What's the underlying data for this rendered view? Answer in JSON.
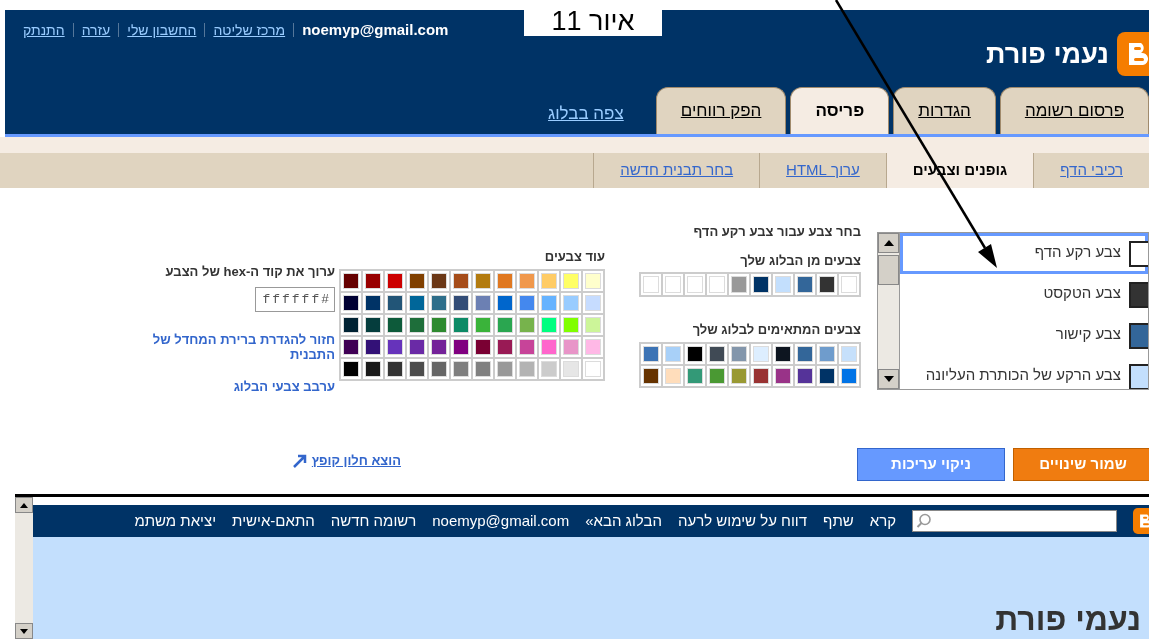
{
  "caption": "איור 11",
  "header": {
    "blog_title": "נעמי פורת",
    "user_email": "noemyp@gmail.com",
    "links": [
      "מרכז שליטה",
      "החשבון שלי",
      "עזרה",
      "התנתק"
    ]
  },
  "tabs": [
    {
      "label": "פרסום רשומה",
      "selected": false
    },
    {
      "label": "הגדרות",
      "selected": false
    },
    {
      "label": "פריסה",
      "selected": true
    },
    {
      "label": "הפק רווחים",
      "selected": false
    }
  ],
  "view_blog_link": "צפה בבלוג",
  "subtabs": [
    {
      "label": "רכיבי הדף",
      "selected": false
    },
    {
      "label": "גופנים וצבעים",
      "selected": true
    },
    {
      "label": "ערוך HTML",
      "selected": false
    },
    {
      "label": "בחר תבנית חדשה",
      "selected": false
    }
  ],
  "element_list": [
    {
      "label": "צבע רקע הדף",
      "color": "#ffffff",
      "selected": true
    },
    {
      "label": "צבע הטקסט",
      "color": "#333333",
      "selected": false
    },
    {
      "label": "צבע קישור",
      "color": "#336699",
      "selected": false
    },
    {
      "label": "צבע הרקע של הכותרת העליונה",
      "color": "#c3dffd",
      "selected": false
    }
  ],
  "picker": {
    "title": "בחר צבע עבור צבע רקע הדף",
    "blog_colors_title": "צבעים מן הבלוג שלך",
    "blog_colors": [
      {
        "color": "#ffffff"
      },
      {
        "color": "#ffffff"
      },
      {
        "color": "#ffffff"
      },
      {
        "color": "#ffffff"
      },
      {
        "color": "#999999"
      },
      {
        "color": "#003366"
      },
      {
        "color": "#c3dffd"
      },
      {
        "color": "#336699"
      },
      {
        "color": "#333333"
      },
      {
        "color": "#ffffff"
      }
    ],
    "matching_title": "צבעים המתאימים לבלוג שלך",
    "matching_colors": [
      [
        {
          "color": "#3d74b5"
        },
        {
          "color": "#a8d0f8"
        },
        {
          "color": "#000000"
        },
        {
          "color": "#404a55"
        },
        {
          "color": "#8396ab"
        },
        {
          "color": "#ddeeff"
        },
        {
          "color": "#0d1520"
        },
        {
          "color": "#336699"
        },
        {
          "color": "#6f9ccc"
        },
        {
          "color": "#c6e0fb"
        }
      ],
      [
        {
          "color": "#663300"
        },
        {
          "color": "#ffddbb"
        },
        {
          "color": "#339977"
        },
        {
          "color": "#4a9933"
        },
        {
          "color": "#999933"
        },
        {
          "color": "#993333"
        },
        {
          "color": "#993388"
        },
        {
          "color": "#553399"
        },
        {
          "color": "#003366"
        },
        {
          "color": "#0073e6"
        }
      ]
    ],
    "more_title": "עוד צבעים",
    "more_colors": [
      [
        {
          "color": "#660000"
        },
        {
          "color": "#990000"
        },
        {
          "color": "#cc0000"
        },
        {
          "color": "#804000"
        },
        {
          "color": "#6b3817"
        },
        {
          "color": "#a64d1a"
        },
        {
          "color": "#b37b0f"
        },
        {
          "color": "#e07820"
        },
        {
          "color": "#f0984c"
        },
        {
          "color": "#ffcc66"
        },
        {
          "color": "#ffff66"
        },
        {
          "color": "#ffffcc"
        }
      ],
      [
        {
          "color": "#000033"
        },
        {
          "color": "#003366"
        },
        {
          "color": "#225577"
        },
        {
          "color": "#006699"
        },
        {
          "color": "#2e6e8a"
        },
        {
          "color": "#334d77"
        },
        {
          "color": "#6c80b3"
        },
        {
          "color": "#0066cc"
        },
        {
          "color": "#4488ee"
        },
        {
          "color": "#66b3ff"
        },
        {
          "color": "#99ccff"
        },
        {
          "color": "#c6dcff"
        }
      ],
      [
        {
          "color": "#002233"
        },
        {
          "color": "#053d3d"
        },
        {
          "color": "#0d5a3a"
        },
        {
          "color": "#1e6e3a"
        },
        {
          "color": "#2e8a30"
        },
        {
          "color": "#0d8a66"
        },
        {
          "color": "#3ab33a"
        },
        {
          "color": "#2aa650"
        },
        {
          "color": "#77b34c"
        },
        {
          "color": "#00ff80"
        },
        {
          "color": "#80ff00"
        },
        {
          "color": "#ccf599"
        }
      ],
      [
        {
          "color": "#400055"
        },
        {
          "color": "#331177"
        },
        {
          "color": "#6633bb"
        },
        {
          "color": "#6a2aa6"
        },
        {
          "color": "#742299"
        },
        {
          "color": "#800080"
        },
        {
          "color": "#7a0033"
        },
        {
          "color": "#991a55"
        },
        {
          "color": "#c74499"
        },
        {
          "color": "#ff66cc"
        },
        {
          "color": "#e895c8"
        },
        {
          "color": "#ffb8e6"
        }
      ],
      [
        {
          "color": "#000000"
        },
        {
          "color": "#1a1a1a"
        },
        {
          "color": "#333333"
        },
        {
          "color": "#4c4c4c"
        },
        {
          "color": "#666666"
        },
        {
          "color": "#7f7f7f"
        },
        {
          "color": "#808080"
        },
        {
          "color": "#999999"
        },
        {
          "color": "#b3b3b3"
        },
        {
          "color": "#cccccc"
        },
        {
          "color": "#e6e6e6"
        },
        {
          "color": "#ffffff"
        }
      ]
    ],
    "hex_title": "ערוך את קוד ה-hex של הצבע",
    "hex_value": "#ffffff",
    "reset_link": "חזור להגדרת ברירת המחדל של התבנית",
    "shuffle_link": "ערבב צבעי הבלוג"
  },
  "popup_link": "הוצא חלון קופץ",
  "buttons": {
    "save": "שמור שינויים",
    "clear": "ניקוי עריכות"
  },
  "preview": {
    "nav_links": [
      "קרא",
      "שתף",
      "דווח על שימוש לרעה",
      "הבלוג הבא»",
      "noemyp@gmail.com",
      "רשומה חדשה",
      "התאם-אישית",
      "יציאת משתמ"
    ],
    "blog_title": "נעמי פורת"
  }
}
